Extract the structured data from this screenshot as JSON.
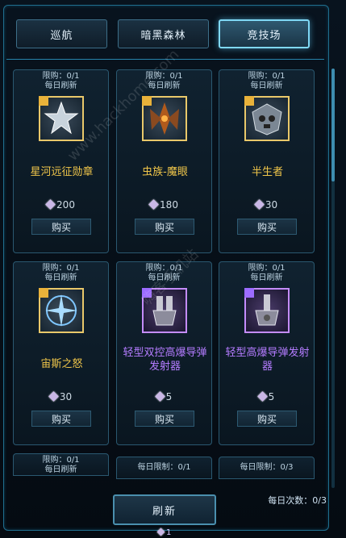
{
  "tabs": [
    {
      "label": "巡航",
      "active": false
    },
    {
      "label": "暗黑森林",
      "active": false
    },
    {
      "label": "竞技场",
      "active": true
    }
  ],
  "cards": [
    {
      "limit": "限购：0/1",
      "daily": "每日刷新",
      "name": "星河远征勋章",
      "price": "200",
      "buy": "购买",
      "rarity": "gold",
      "icon": "star-medal-icon"
    },
    {
      "limit": "限购：0/1",
      "daily": "每日刷新",
      "name": "虫族-魔眼",
      "price": "180",
      "buy": "购买",
      "rarity": "gold",
      "icon": "demon-eye-icon"
    },
    {
      "limit": "限购：0/1",
      "daily": "每日刷新",
      "name": "半生者",
      "price": "30",
      "buy": "购买",
      "rarity": "gold",
      "icon": "skull-helmet-icon"
    },
    {
      "limit": "限购：0/1",
      "daily": "每日刷新",
      "name": "宙斯之怒",
      "price": "30",
      "buy": "购买",
      "rarity": "gold",
      "icon": "compass-star-icon"
    },
    {
      "limit": "限购：0/1",
      "daily": "每日刷新",
      "name": "轻型双控高爆导弹发射器",
      "price": "5",
      "buy": "购买",
      "rarity": "purple",
      "icon": "missile-launcher-icon"
    },
    {
      "limit": "限购：0/1",
      "daily": "每日刷新",
      "name": "轻型高爆导弹发射器",
      "price": "5",
      "buy": "购买",
      "rarity": "purple",
      "icon": "missile-launcher-icon"
    }
  ],
  "partial_cards": [
    {
      "line1": "限购：0/1",
      "line2": "每日刷新"
    },
    {
      "line1": "每日限制：0/1",
      "line2": ""
    },
    {
      "line1": "每日限制：0/3",
      "line2": ""
    }
  ],
  "refresh_label": "刷新",
  "daily_count_label": "每日次数：",
  "daily_count_value": "0/3",
  "refresh_cost": "1",
  "watermarks": [
    "www.hackhome.com",
    "嗨客手机站"
  ]
}
